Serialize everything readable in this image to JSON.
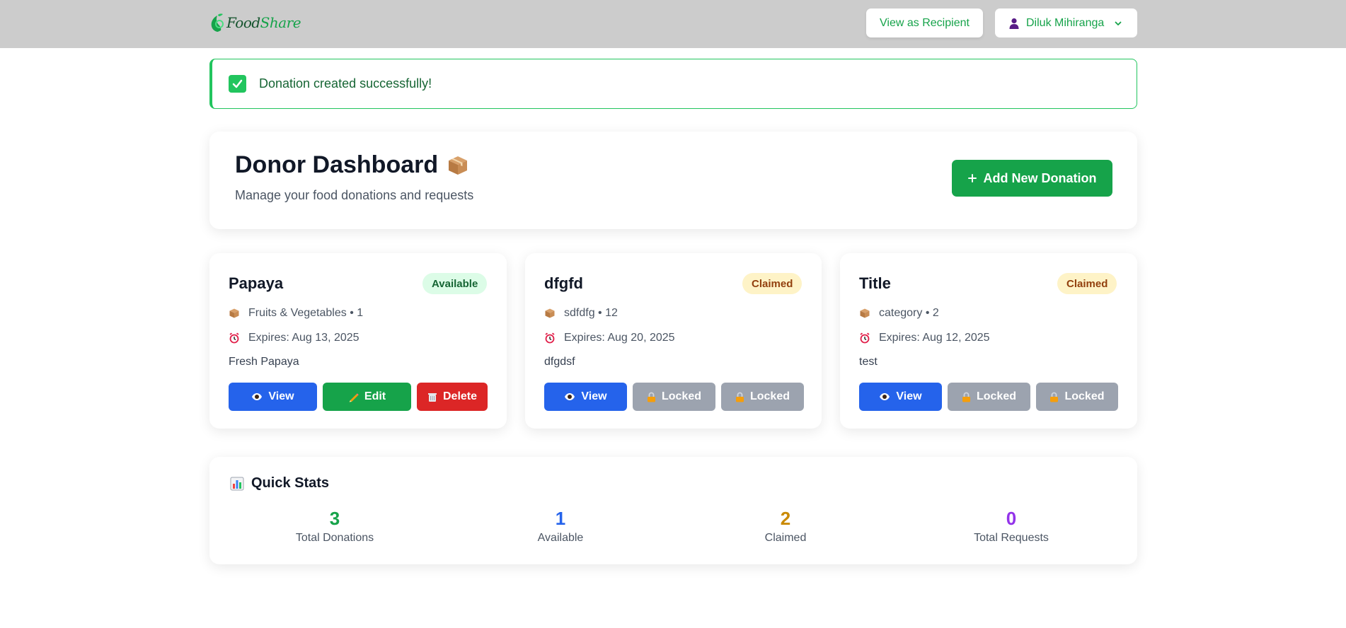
{
  "app": {
    "logo_text_a": "Food",
    "logo_text_b": "Share"
  },
  "header": {
    "view_as_recipient": "View as Recipient",
    "user_name": "Diluk Mihiranga"
  },
  "alert": {
    "message": "Donation created successfully!"
  },
  "dashboard": {
    "title": "Donor Dashboard",
    "subtitle": "Manage your food donations and requests",
    "add_button": "Add New Donation"
  },
  "donations": [
    {
      "name": "Papaya",
      "status": "Available",
      "category": "Fruits & Vegetables • 1",
      "expires": "Expires: Aug 13, 2025",
      "description": "Fresh Papaya",
      "actions": [
        "View",
        "Edit",
        "Delete"
      ]
    },
    {
      "name": "dfgfd",
      "status": "Claimed",
      "category": "sdfdfg • 12",
      "expires": "Expires: Aug 20, 2025",
      "description": "dfgdsf",
      "actions": [
        "View",
        "Locked",
        "Locked"
      ]
    },
    {
      "name": "Title",
      "status": "Claimed",
      "category": "category • 2",
      "expires": "Expires: Aug 12, 2025",
      "description": "test",
      "actions": [
        "View",
        "Locked",
        "Locked"
      ]
    }
  ],
  "stats": {
    "title": "Quick Stats",
    "items": [
      {
        "value": "3",
        "label": "Total Donations",
        "color": "#16a34a"
      },
      {
        "value": "1",
        "label": "Available",
        "color": "#2563eb"
      },
      {
        "value": "2",
        "label": "Claimed",
        "color": "#ca8a04"
      },
      {
        "value": "0",
        "label": "Total Requests",
        "color": "#9333ea"
      }
    ]
  },
  "colors": {
    "brand_green": "#16a34a",
    "action_blue": "#2563eb",
    "danger_red": "#dc2626",
    "locked_gray": "#9ca3af",
    "topbar": "#cccccc"
  },
  "icons": {
    "logo": "leaf-icon",
    "alert": "check-icon",
    "title": "package-icon",
    "add": "plus-icon",
    "category": "package-icon",
    "expires": "alarm-clock-icon",
    "view": "eye-icon",
    "edit": "pencil-icon",
    "delete": "trash-icon",
    "locked": "lock-icon",
    "stats": "bar-chart-icon",
    "user": "user-icon",
    "dropdown": "chevron-down-icon"
  }
}
